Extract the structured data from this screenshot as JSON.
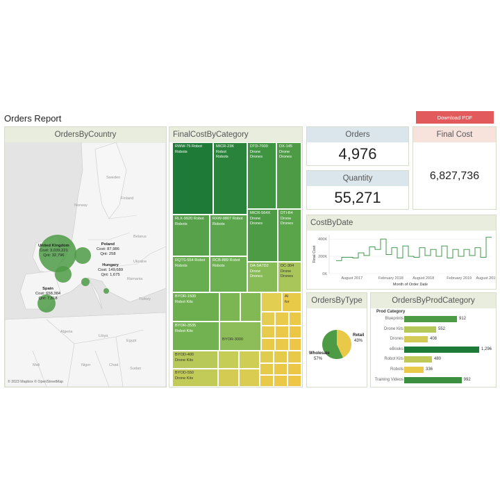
{
  "report": {
    "title": "Orders Report",
    "download_label": "Download PDF"
  },
  "colors": {
    "dark_green": "#1e7b37",
    "green": "#4e9b46",
    "light_green": "#7fbb58",
    "yellow": "#e8c948",
    "download_red": "#e25a5b"
  },
  "panels": {
    "country": {
      "title": "OrdersByCountry"
    },
    "category": {
      "title": "FinalCostByCategory"
    },
    "orders": {
      "title": "Orders",
      "value": "4,976"
    },
    "quantity": {
      "title": "Quantity",
      "value": "55,271"
    },
    "final_cost": {
      "title": "Final Cost",
      "value": "6,827,736"
    },
    "cost_by_date": {
      "title": "CostByDate"
    },
    "by_type": {
      "title": "OrdersByType"
    },
    "by_prod": {
      "title": "OrdersByProdCategory"
    }
  },
  "map": {
    "attribution": "© 2023 Mapbox © OpenStreetMap",
    "labels": [
      "Sweden",
      "Norway",
      "Finland",
      "Poland",
      "Belarus",
      "Ukraine",
      "Romania",
      "Hungary",
      "Turkey",
      "Spain",
      "Algeria",
      "Libya",
      "Egypt",
      "Mali",
      "Niger",
      "Chad",
      "Sudan",
      "Nigeria",
      "United Kingdom",
      "Italy"
    ],
    "countries": [
      {
        "name": "United Kingdom",
        "cost": "Cost: 3,039,221",
        "qnt": "Qnt: 32,796"
      },
      {
        "name": "Poland",
        "cost": "Cost: 87,986",
        "qnt": "Qnt: 258"
      },
      {
        "name": "Hungary",
        "cost": "Cost: 149,689",
        "qnt": "Qnt: 1,675"
      },
      {
        "name": "Spain",
        "cost": "Cost: 658,384",
        "qnt": "Qnt: 7,818"
      }
    ]
  },
  "treemap": {
    "tiles": [
      {
        "line1": "RWW-75 Robot",
        "line2": "Robots",
        "line3": ""
      },
      {
        "line1": "MICR-23K",
        "line2": "Robot",
        "line3": "Robots"
      },
      {
        "line1": "DTD-7000",
        "line2": "Drone",
        "line3": "Drones"
      },
      {
        "line1": "DX-145",
        "line2": "Drone",
        "line3": "Drones"
      },
      {
        "line1": "RLX-9920 Robot",
        "line2": "Robots",
        "line3": ""
      },
      {
        "line1": "RXW-9807 Robot",
        "line2": "Robots",
        "line3": ""
      },
      {
        "line1": "MICR-564X",
        "line2": "Drone",
        "line3": "Drones"
      },
      {
        "line1": "DTI-B4",
        "line2": "Drone",
        "line3": "Drones"
      },
      {
        "line1": "RQTS-554 Robot",
        "line2": "Robots",
        "line3": ""
      },
      {
        "line1": "RCB-889 Robot",
        "line2": "Robots",
        "line3": ""
      },
      {
        "line1": "DA-5A7D2",
        "line2": "Drone",
        "line3": "Drones"
      },
      {
        "line1": "DC-304",
        "line2": "Drone",
        "line3": "Drones"
      },
      {
        "line1": "BYOR-1500",
        "line2": "Robot Kits",
        "line3": ""
      },
      {
        "line1": "BYOR-3535",
        "line2": "Robot Kits",
        "line3": ""
      },
      {
        "line1": "BYOR-3000",
        "line2": "",
        "line3": ""
      },
      {
        "line1": "AI",
        "line2": "for",
        "line3": ""
      },
      {
        "line1": "BYOD-400",
        "line2": "Drone Kits",
        "line3": ""
      },
      {
        "line1": "BYOD-550",
        "line2": "Drone Kits",
        "line3": ""
      }
    ]
  },
  "chart_data": [
    {
      "type": "line",
      "title": "CostByDate",
      "xlabel": "Month of Order Date",
      "ylabel": "Final Cost",
      "y_ticks": [
        "400K",
        "200K",
        "0K"
      ],
      "x_ticks": [
        "August 2017",
        "February 2018",
        "August 2018",
        "February 2019",
        "August 2019"
      ],
      "ylim": [
        0,
        450000
      ],
      "x": [
        "2017-05",
        "2017-06",
        "2017-07",
        "2017-08",
        "2017-09",
        "2017-10",
        "2017-11",
        "2017-12",
        "2018-01",
        "2018-02",
        "2018-03",
        "2018-04",
        "2018-05",
        "2018-06",
        "2018-07",
        "2018-08",
        "2018-09",
        "2018-10",
        "2018-11",
        "2018-12",
        "2019-01",
        "2019-02",
        "2019-03",
        "2019-04",
        "2019-05",
        "2019-06",
        "2019-07",
        "2019-08"
      ],
      "values": [
        150000,
        190000,
        190000,
        180000,
        240000,
        210000,
        310000,
        280000,
        400000,
        220000,
        300000,
        180000,
        320000,
        200000,
        190000,
        300000,
        210000,
        280000,
        200000,
        320000,
        180000,
        280000,
        200000,
        280000,
        210000,
        300000,
        190000,
        420000
      ]
    },
    {
      "type": "pie",
      "title": "OrdersByType",
      "categories": [
        "Retail",
        "Wholesale"
      ],
      "values": [
        43,
        57
      ],
      "labels": [
        "Retail",
        "43%",
        "Wholesale",
        "57%"
      ]
    },
    {
      "type": "bar",
      "title": "OrdersByProdCategory",
      "header": "Prod Category",
      "categories": [
        "Blueprints",
        "Drone Kits",
        "Drones",
        "eBooks",
        "Robot Kits",
        "Robots",
        "Training Videos"
      ],
      "values": [
        912,
        552,
        408,
        1296,
        480,
        336,
        992
      ],
      "value_labels": [
        "912",
        "552",
        "408",
        "1,296",
        "480",
        "336",
        "992"
      ],
      "xlim": [
        0,
        1296
      ]
    }
  ]
}
